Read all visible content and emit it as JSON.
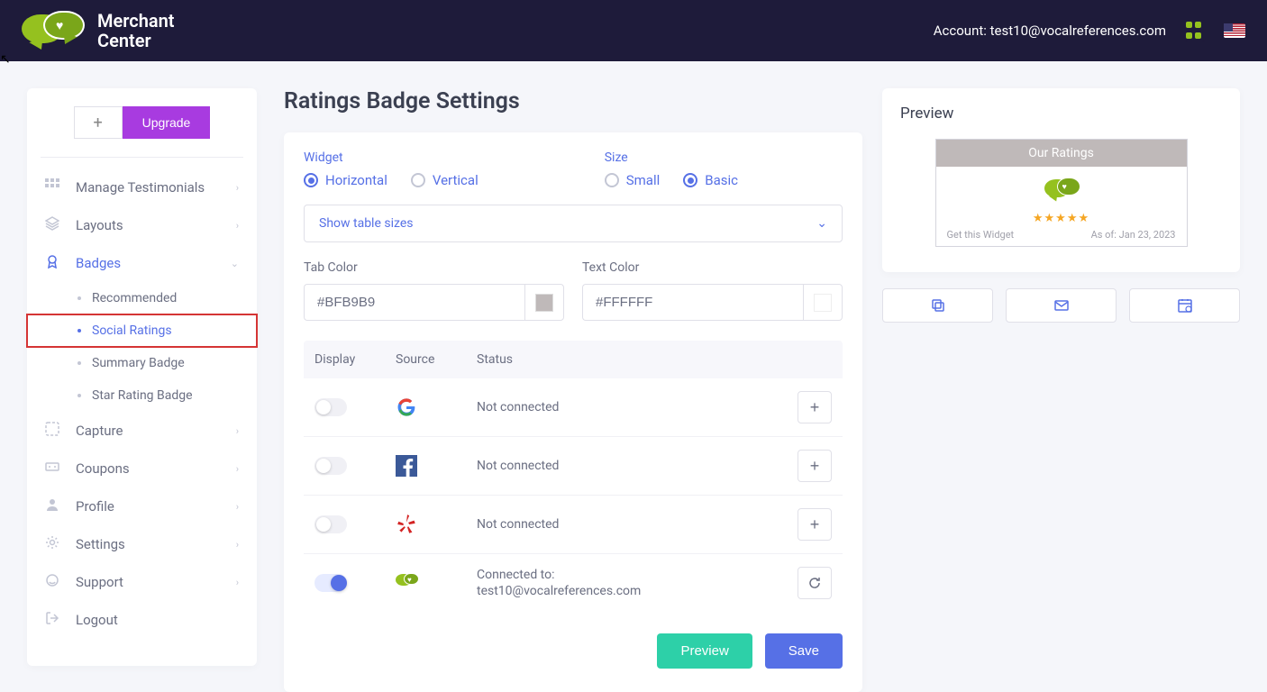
{
  "header": {
    "brand_line1": "Merchant",
    "brand_line2": "Center",
    "account_label": "Account:",
    "account_email": "test10@vocalreferences.com"
  },
  "sidebar": {
    "upgrade_label": "Upgrade",
    "items": [
      {
        "label": "Manage Testimonials",
        "icon": "grid"
      },
      {
        "label": "Layouts",
        "icon": "layers"
      },
      {
        "label": "Badges",
        "icon": "badge",
        "active": true,
        "expanded": true
      },
      {
        "label": "Capture",
        "icon": "capture"
      },
      {
        "label": "Coupons",
        "icon": "coupon"
      },
      {
        "label": "Profile",
        "icon": "user"
      },
      {
        "label": "Settings",
        "icon": "gear"
      },
      {
        "label": "Support",
        "icon": "support"
      },
      {
        "label": "Logout",
        "icon": "logout"
      }
    ],
    "badges_children": [
      {
        "label": "Recommended"
      },
      {
        "label": "Social Ratings",
        "active": true,
        "highlighted": true
      },
      {
        "label": "Summary Badge"
      },
      {
        "label": "Star Rating Badge"
      }
    ]
  },
  "page": {
    "title": "Ratings Badge Settings",
    "widget_label": "Widget",
    "widget_options": [
      "Horizontal",
      "Vertical"
    ],
    "widget_selected": "Horizontal",
    "size_label": "Size",
    "size_options": [
      "Small",
      "Basic"
    ],
    "size_selected": "Basic",
    "select_placeholder": "Show table sizes",
    "tab_color_label": "Tab Color",
    "tab_color_value": "#BFB9B9",
    "text_color_label": "Text Color",
    "text_color_value": "#FFFFFF",
    "table_headers": {
      "display": "Display",
      "source": "Source",
      "status": "Status"
    },
    "sources": [
      {
        "name": "google",
        "connected": false,
        "status": "Not connected",
        "toggle": false,
        "action": "add"
      },
      {
        "name": "facebook",
        "connected": false,
        "status": "Not connected",
        "toggle": false,
        "action": "add"
      },
      {
        "name": "yelp",
        "connected": false,
        "status": "Not connected",
        "toggle": false,
        "action": "add"
      },
      {
        "name": "vocalreferences",
        "connected": true,
        "status": "Connected to:\ntest10@vocalreferences.com",
        "toggle": true,
        "action": "refresh"
      }
    ],
    "connected_line1": "Connected to:",
    "connected_line2": "test10@vocalreferences.com",
    "preview_btn": "Preview",
    "save_btn": "Save"
  },
  "preview": {
    "title": "Preview",
    "widget_heading": "Our Ratings",
    "get_widget": "Get this Widget",
    "as_of": "As of: Jan 23, 2023"
  }
}
